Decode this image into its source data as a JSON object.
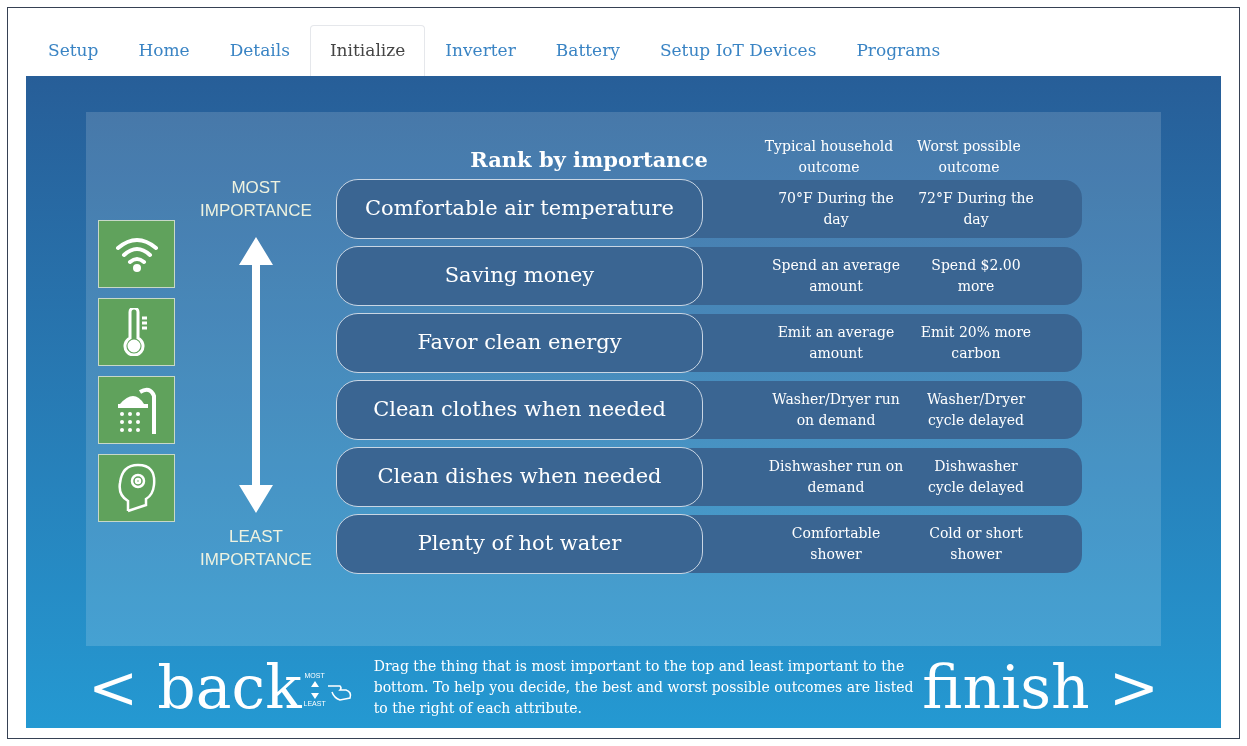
{
  "tabs": [
    {
      "label": "Setup",
      "selected": false
    },
    {
      "label": "Home",
      "selected": false
    },
    {
      "label": "Details",
      "selected": false
    },
    {
      "label": "Initialize",
      "selected": true
    },
    {
      "label": "Inverter",
      "selected": false
    },
    {
      "label": "Battery",
      "selected": false
    },
    {
      "label": "Setup IoT Devices",
      "selected": false
    },
    {
      "label": "Programs",
      "selected": false
    }
  ],
  "ranking": {
    "title": "Rank by importance",
    "columns": [
      "Typical household outcome",
      "Worst possible outcome"
    ],
    "scale_top": "MOST IMPORTANCE",
    "scale_bottom": "LEAST IMPORTANCE",
    "rows": [
      {
        "label": "Comfortable air temperature",
        "typical": "70°F During the day",
        "worst": "72°F During the day"
      },
      {
        "label": "Saving money",
        "typical": "Spend an average amount",
        "worst": "Spend $2.00 more"
      },
      {
        "label": "Favor clean energy",
        "typical": "Emit an average amount",
        "worst": "Emit 20% more carbon"
      },
      {
        "label": "Clean clothes when needed",
        "typical": "Washer/Dryer run on demand",
        "worst": "Washer/Dryer cycle delayed"
      },
      {
        "label": "Clean dishes when needed",
        "typical": "Dishwasher run on demand",
        "worst": "Dishwasher cycle delayed"
      },
      {
        "label": "Plenty of hot water",
        "typical": "Comfortable shower",
        "worst": "Cold or short shower"
      }
    ]
  },
  "footer": {
    "back": "< back",
    "drag_top": "MOST",
    "drag_bottom": "LEAST",
    "instructions": "Drag the thing that is most important to the top and least important to the bottom. To help you decide, the best and worst possible outcomes are listed to the right of each attribute.",
    "finish": "finish >"
  }
}
